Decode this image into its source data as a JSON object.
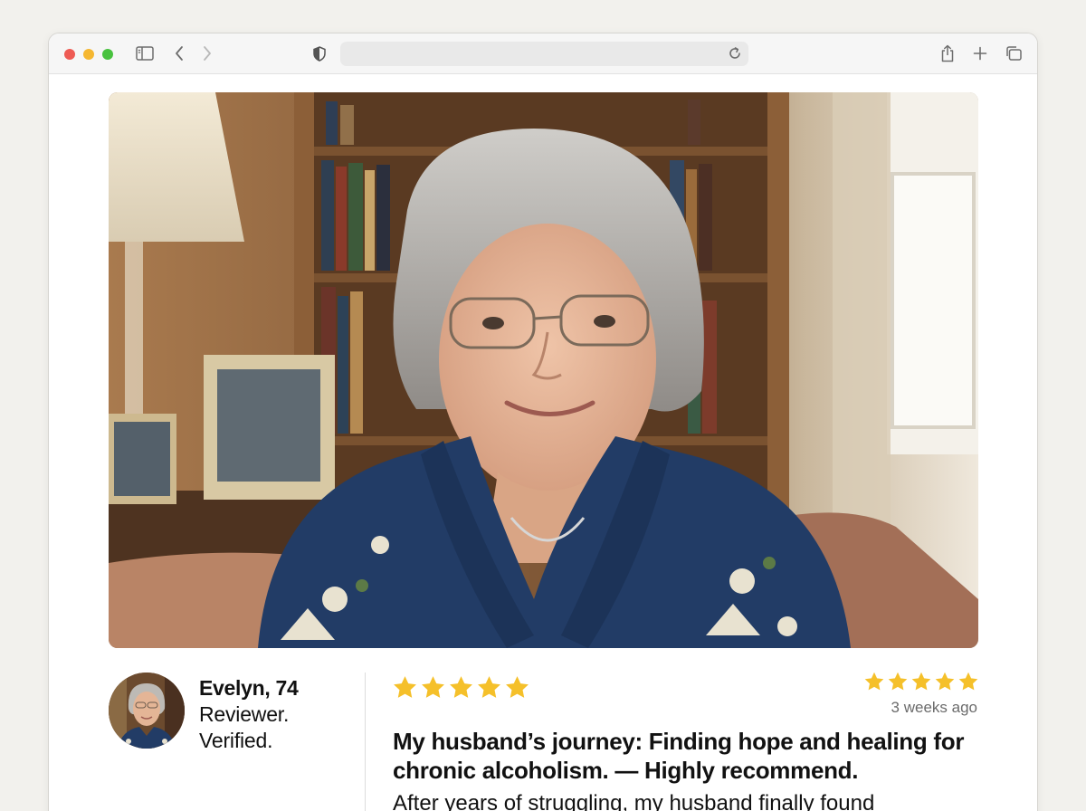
{
  "browser": {
    "url": ""
  },
  "hero": {
    "image_subject": "portrait photo of a smiling elderly woman with gray hair and glasses, wearing a blue knit cardigan, in front of bookshelves"
  },
  "reviewer": {
    "name": "Evelyn, 74",
    "role": "Reviewer.",
    "status": "Verified."
  },
  "review": {
    "rating": 5,
    "rating_max": 5,
    "posted": "3 weeks ago",
    "title": "My husband’s journey: Finding hope and healing for chronic alcoholism. — Highly recommend.",
    "body": "After years of struggling, my husband finally found"
  },
  "colors": {
    "star": "#f5c02a",
    "traffic_red": "#ee5b54",
    "traffic_yellow": "#f5b731",
    "traffic_green": "#49c23f"
  },
  "icons": {
    "sidebar": "sidebar-icon",
    "back": "chevron-left-icon",
    "forward": "chevron-right-icon",
    "privacy": "shield-icon",
    "reload": "reload-icon",
    "share": "share-icon",
    "new_tab": "plus-icon",
    "tabs": "tabs-overview-icon"
  }
}
